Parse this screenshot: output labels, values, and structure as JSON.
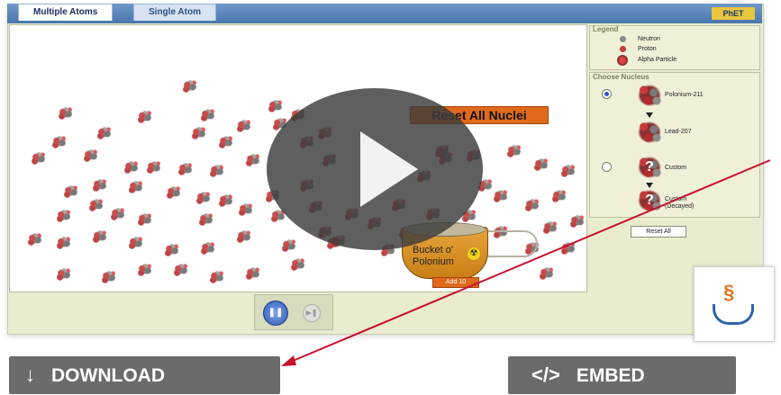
{
  "tabs": [
    {
      "label": "Multiple Atoms",
      "active": true
    },
    {
      "label": "Single Atom",
      "active": false
    }
  ],
  "logo": "PhET",
  "play_area": {
    "reset_button": "Reset All Nuclei",
    "bucket": {
      "label": "Bucket o' Polonium",
      "add_button": "Add 10",
      "icon": "radiation-icon"
    }
  },
  "legend": {
    "title": "Legend",
    "items": [
      {
        "label": "Neutron",
        "color": "#8a8a8a"
      },
      {
        "label": "Proton",
        "color": "#c73a3a"
      },
      {
        "label": "Alpha Particle",
        "color": "#b33030"
      }
    ]
  },
  "choose_nucleus": {
    "title": "Choose Nucleus",
    "options": [
      {
        "selected": true,
        "parent": "Polonium-211",
        "daughter": "Lead-207"
      },
      {
        "selected": false,
        "parent": "Custom",
        "daughter": "Custom (Decayed)"
      }
    ],
    "reset_button": "Reset All"
  },
  "clock": {
    "pause_icon": "pause-icon",
    "step_icon": "step-icon"
  },
  "video": {
    "play_icon": "play-icon"
  },
  "java": {
    "icon": "java-logo"
  },
  "actions": {
    "download": {
      "label": "DOWNLOAD",
      "icon": "↓"
    },
    "embed": {
      "label": "EMBED",
      "icon": "</>"
    }
  },
  "colors": {
    "accent_orange": "#e06a1c",
    "tab_bar": "#4a76ad",
    "button_gray": "#6b6b6b",
    "annotation_red": "#c8102e"
  }
}
